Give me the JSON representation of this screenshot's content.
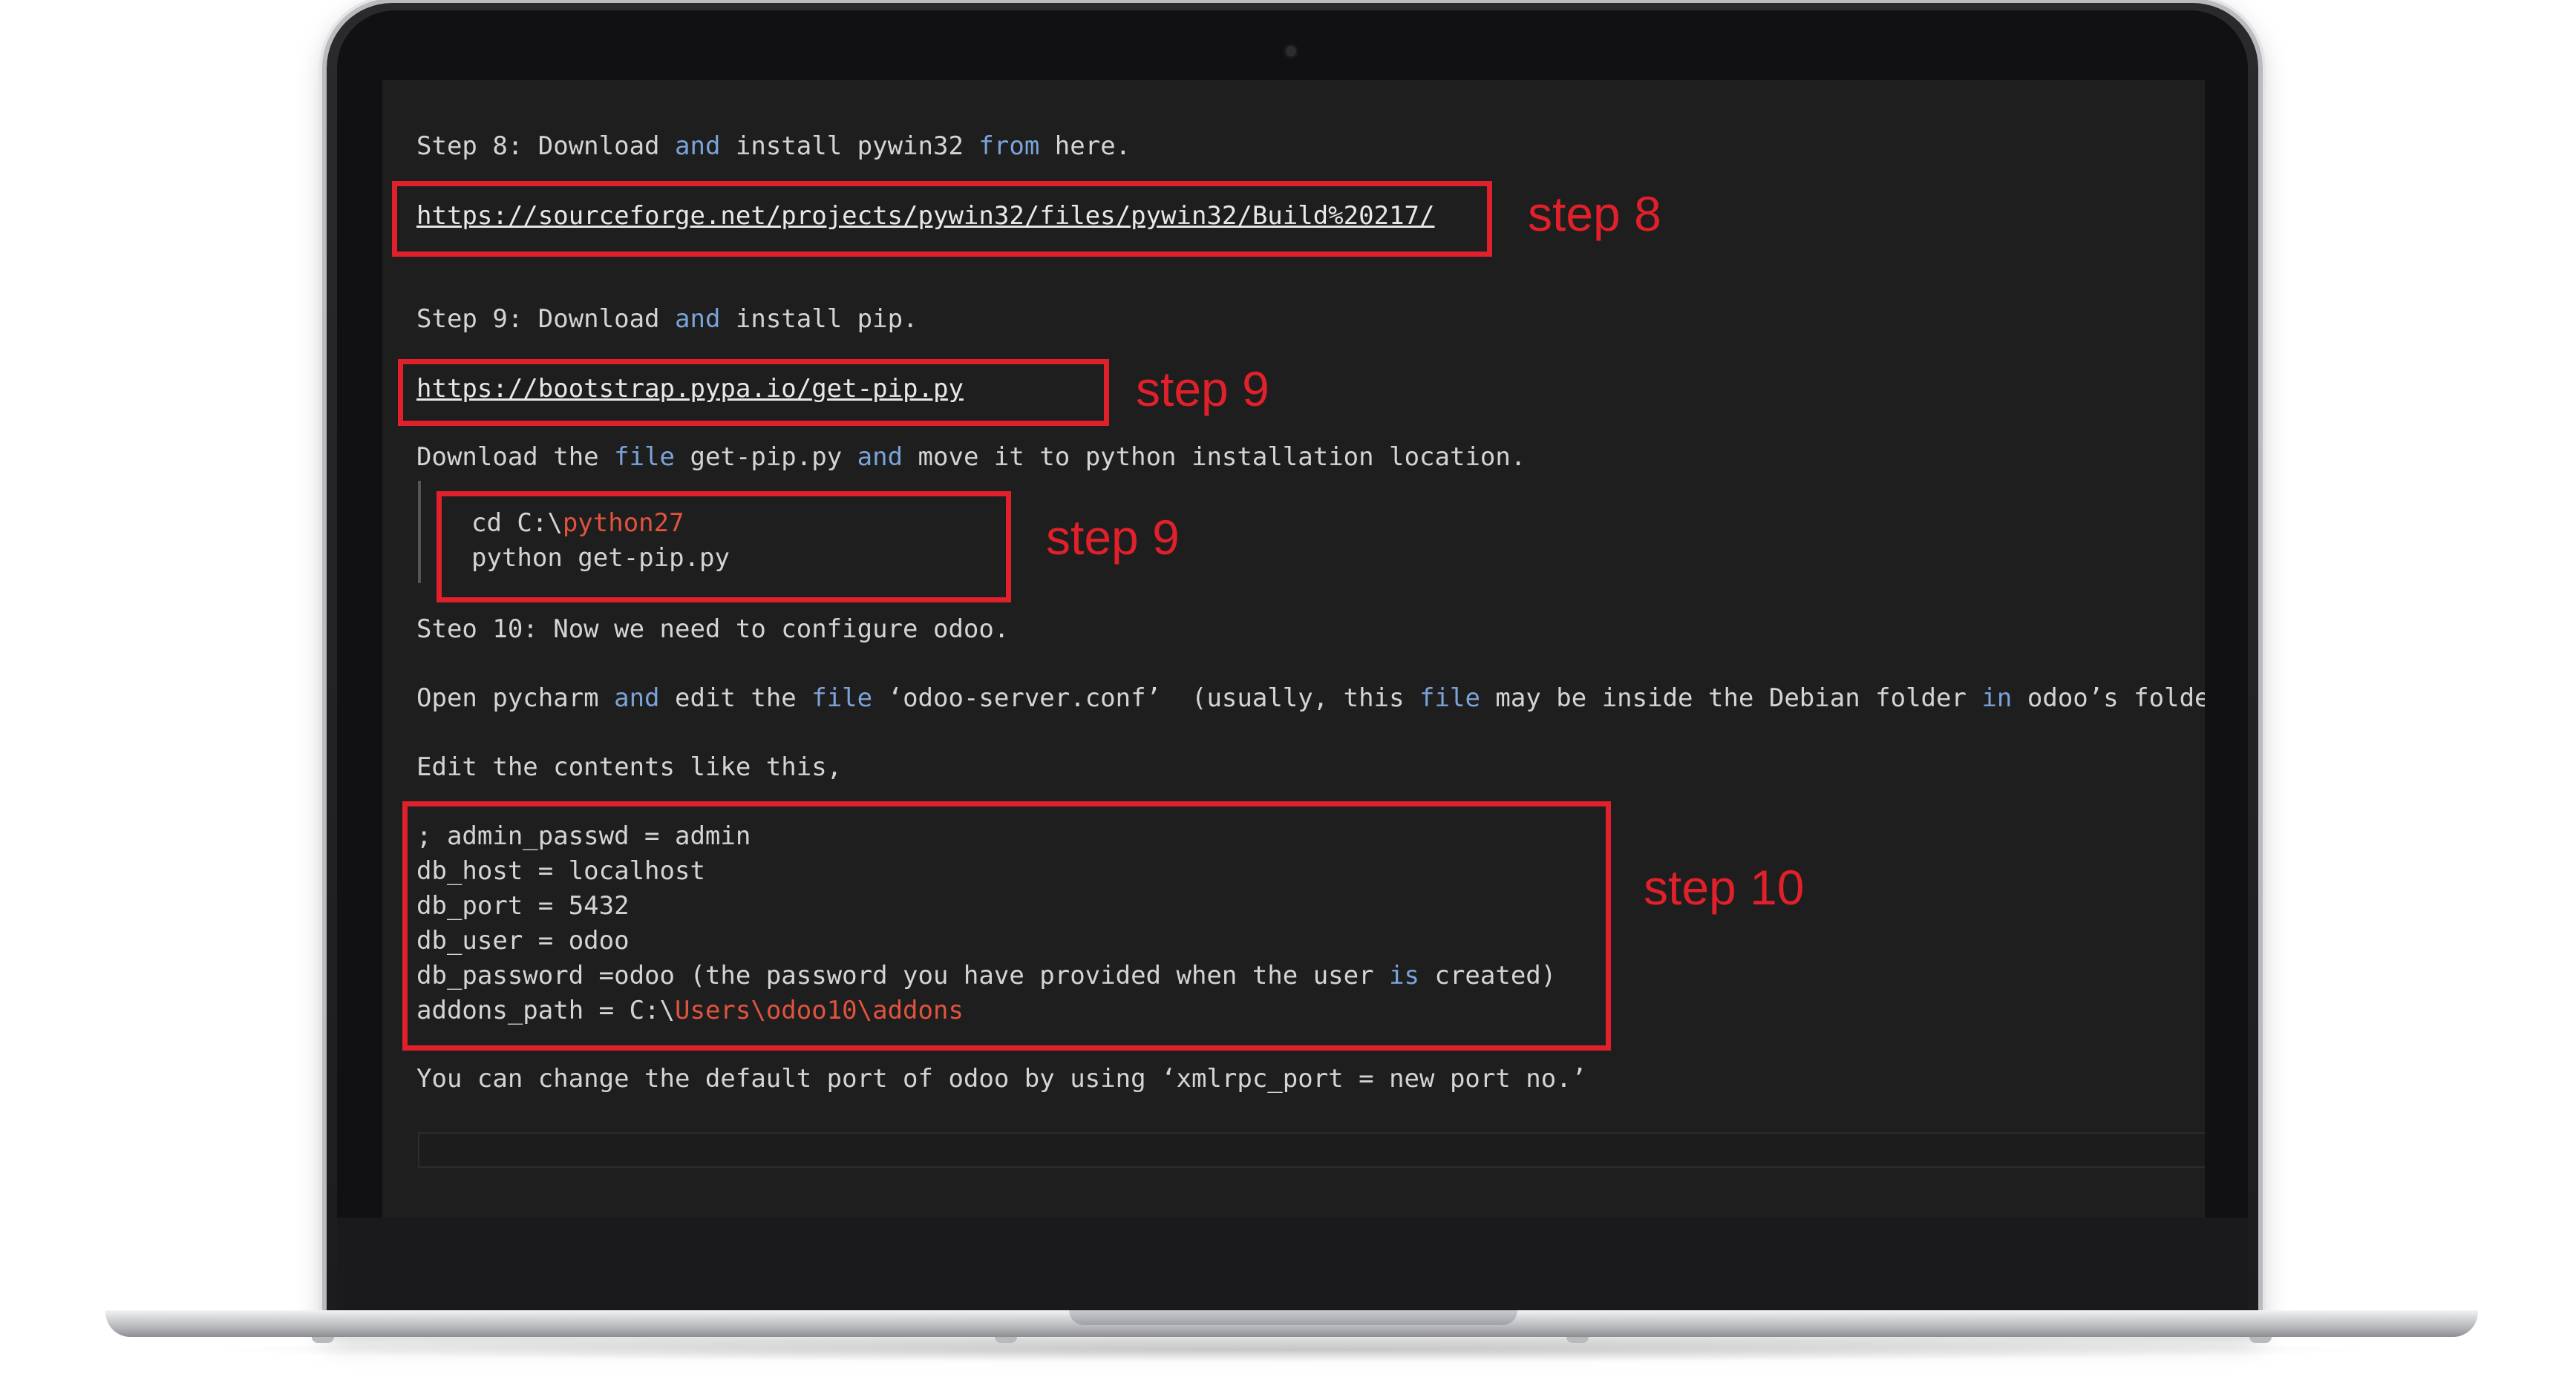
{
  "lines": {
    "step8": {
      "a": "Step 8: Download ",
      "k1": "and",
      "b": " install pywin32 ",
      "k2": "from",
      "c": " here."
    },
    "link8": "https://sourceforge.net/projects/pywin32/files/pywin32/Build%20217/",
    "step9": {
      "a": "Step 9: Download ",
      "k1": "and",
      "b": " install pip."
    },
    "link9": "https://bootstrap.pypa.io/get-pip.py",
    "move": {
      "a": "Download the ",
      "k1": "file",
      "b": " get-pip.py ",
      "k2": "and",
      "c": " move it to python installation location."
    },
    "code1": {
      "a": "cd C:\\",
      "r": "python27"
    },
    "code2": "python get-pip.py",
    "step10": "Steo 10: Now we need to configure odoo.",
    "open": {
      "a": "Open pycharm ",
      "k1": "and",
      "b": " edit the ",
      "k2": "file",
      "c": " ‘odoo-server.conf’  (usually, this ",
      "k3": "file",
      "d": " may be inside the Debian folder ",
      "k4": "in",
      "e": " odoo’s folder)"
    },
    "edit": "Edit the contents like this,",
    "conf1": "; admin_passwd = admin",
    "conf2": "db_host = localhost",
    "conf3": "db_port = 5432",
    "conf4": "db_user = odoo",
    "conf5": {
      "a": "db_password =odoo (the password you have provided when the user ",
      "k1": "is",
      "b": " created)"
    },
    "conf6": {
      "a": "addons_path = C:\\",
      "r": "Users\\odoo10\\addons"
    },
    "change": "You can change the default port of odoo by using ‘xmlrpc_port = new port no.’"
  },
  "annotations": {
    "label_a": "step 8",
    "label_b": "step 9",
    "label_c": "step 9",
    "label_d": "step 10"
  },
  "colors": {
    "annotation": "#e0202a",
    "keyword": "#7aa3d8",
    "path": "#e0533f",
    "editor_bg": "#1e1e1e"
  }
}
